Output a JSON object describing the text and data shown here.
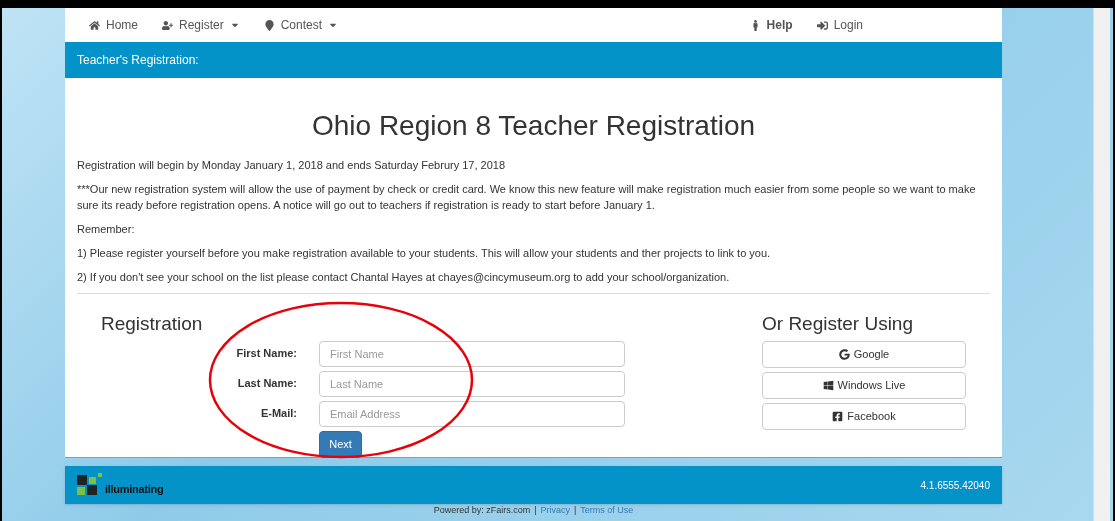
{
  "nav": {
    "left": [
      {
        "label": "Home",
        "caret": false
      },
      {
        "label": "Register",
        "caret": true
      },
      {
        "label": "Contest",
        "caret": true
      }
    ],
    "right": [
      {
        "label": "Help",
        "bold": true
      },
      {
        "label": "Login",
        "bold": false
      }
    ]
  },
  "header_bar": "Teacher's Registration:",
  "title": "Ohio Region 8 Teacher Registration",
  "paragraphs": [
    "Registration will begin by Monday January 1, 2018 and ends Saturday Februry 17, 2018",
    "***Our new registration system will allow the use of payment by check or credit card. We know this new feature will make registration much easier from some people so we want to make sure its ready before registration opens. A notice will go out to teachers if registration is ready to start before January 1.",
    "Remember:",
    "1) Please register yourself before you make registration available to your students. This will allow your students and ther projects to link to you.",
    "2) If you don't see your school on the list please contact Chantal Hayes at chayes@cincymuseum.org to add your school/organization."
  ],
  "registration": {
    "heading": "Registration",
    "fields": [
      {
        "label": "First Name:",
        "placeholder": "First Name"
      },
      {
        "label": "Last Name:",
        "placeholder": "Last Name"
      },
      {
        "label": "E-Mail:",
        "placeholder": "Email Address"
      }
    ],
    "submit": "Next"
  },
  "social": {
    "heading": "Or Register Using",
    "buttons": [
      {
        "label": "Google"
      },
      {
        "label": "Windows Live"
      },
      {
        "label": "Facebook"
      }
    ]
  },
  "footer": {
    "logo_text": "illuminating",
    "version": "4.1.6555.42040"
  },
  "powered_by": [
    {
      "kind": "text",
      "text": "Powered by: zFairs.com"
    },
    {
      "kind": "text",
      "text": "|"
    },
    {
      "kind": "link",
      "text": "Privacy"
    },
    {
      "kind": "text",
      "text": "|"
    },
    {
      "kind": "link",
      "text": "Terms of Use"
    }
  ]
}
